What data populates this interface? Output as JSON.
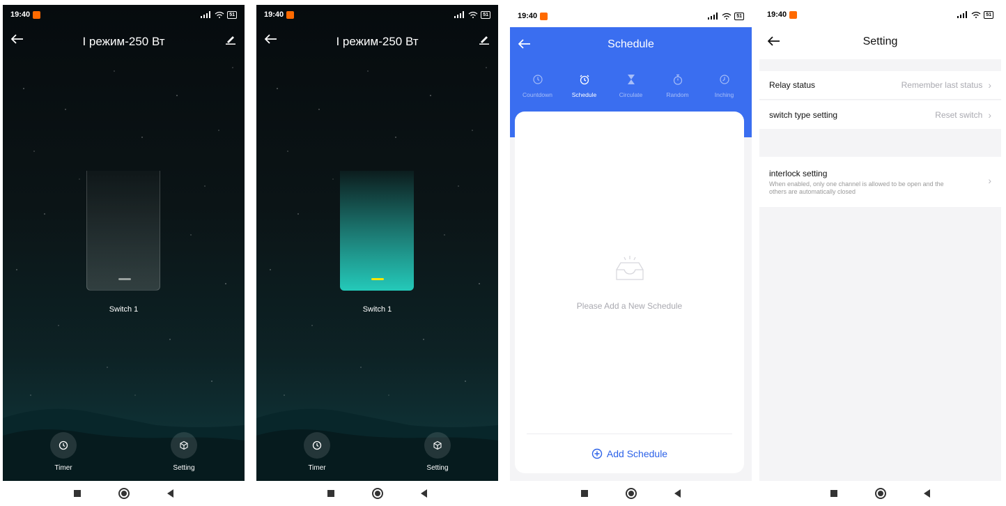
{
  "status_bar": {
    "time": "19:40",
    "battery": "51"
  },
  "screen1": {
    "title": "I режим-250 Вт",
    "switch_label": "Switch 1",
    "timer_label": "Timer",
    "setting_label": "Setting",
    "switch_state": "off"
  },
  "screen2": {
    "title": "I режим-250 Вт",
    "switch_label": "Switch 1",
    "timer_label": "Timer",
    "setting_label": "Setting",
    "switch_state": "on"
  },
  "screen3": {
    "title": "Schedule",
    "tabs": [
      {
        "label": "Countdown",
        "icon": "clock-icon"
      },
      {
        "label": "Schedule",
        "icon": "alarm-icon"
      },
      {
        "label": "Circulate",
        "icon": "hourglass-icon"
      },
      {
        "label": "Random",
        "icon": "stopwatch-icon"
      },
      {
        "label": "Inching",
        "icon": "timer-icon"
      }
    ],
    "active_tab": "Schedule",
    "empty_text": "Please Add a New Schedule",
    "add_label": "Add Schedule"
  },
  "screen4": {
    "title": "Setting",
    "relay_label": "Relay status",
    "relay_value": "Remember last status",
    "switch_type_label": "switch type setting",
    "switch_type_value": "Reset switch",
    "interlock_label": "interlock setting",
    "interlock_desc": "When enabled, only one channel is allowed to be open and the others are automatically closed"
  },
  "colors": {
    "accent_blue": "#3a6ef0",
    "switch_on": "#24c9b9",
    "indicator_on": "#ffe600"
  }
}
